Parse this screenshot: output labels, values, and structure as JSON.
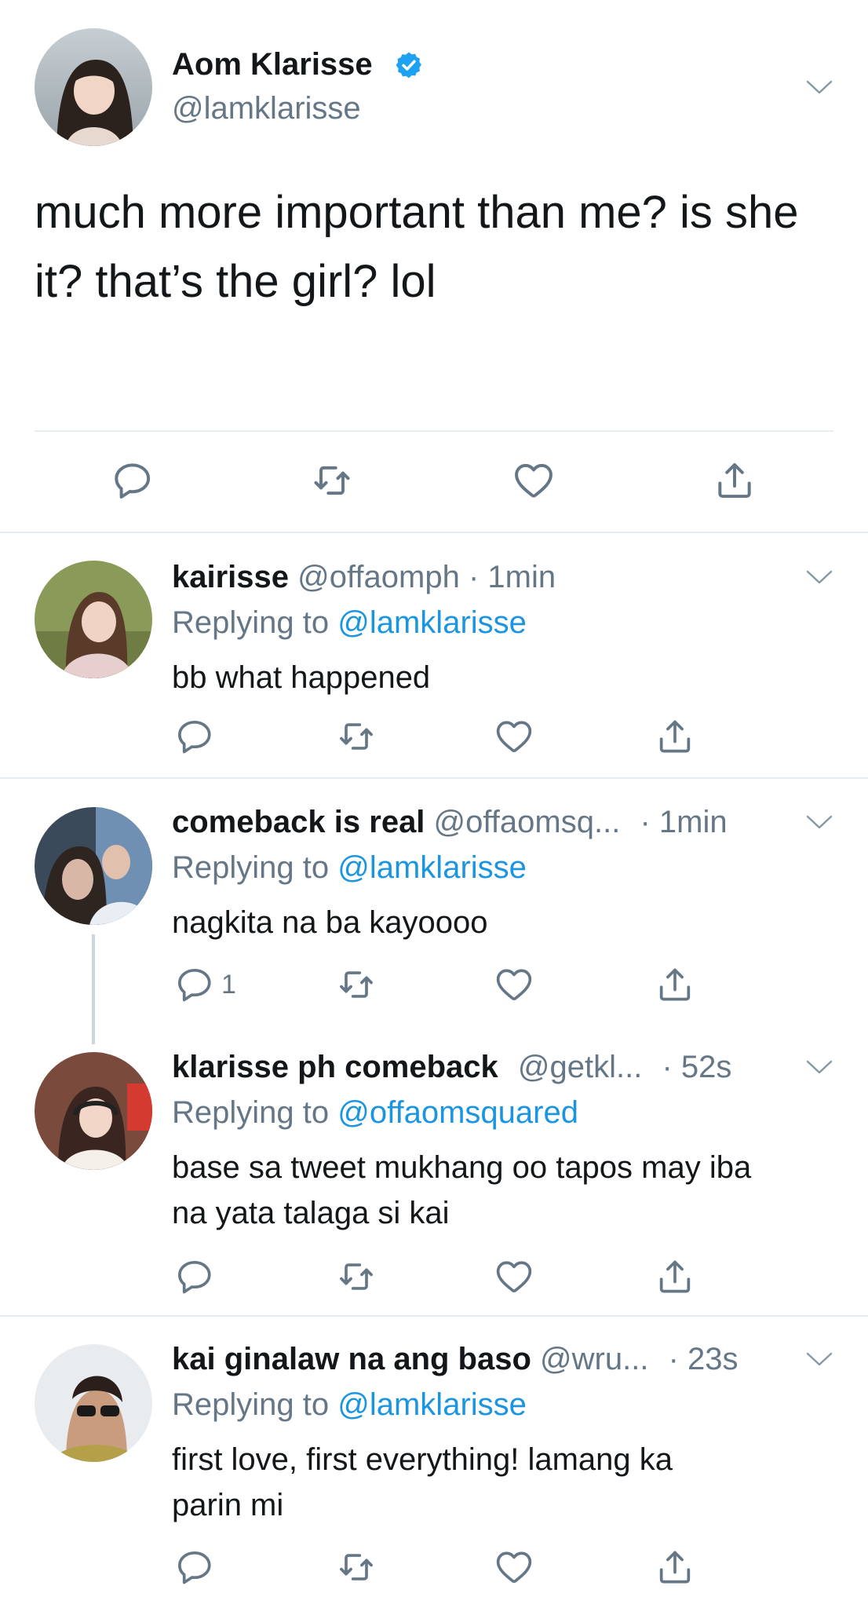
{
  "main_tweet": {
    "author_name": "Aom Klarisse",
    "handle": "@lamklarisse",
    "text_line1": "much more important than me? is she",
    "text_line2": "it? that’s the girl? lol"
  },
  "replies": [
    {
      "name": "kairisse",
      "handle": "@offaomph",
      "time": "· 1min",
      "replying_label": "Replying to",
      "replying_to": "@lamklarisse",
      "text_line1": "bb what happened",
      "text_line2": "",
      "reply_count": ""
    },
    {
      "name": "comeback is real",
      "handle": "@offaomsq...",
      "time": "· 1min",
      "replying_label": "Replying to",
      "replying_to": "@lamklarisse",
      "text_line1": "nagkita na ba kayoooo",
      "text_line2": "",
      "reply_count": "1"
    },
    {
      "name": "klarisse ph comeback",
      "handle": "@getkl...",
      "time": "· 52s",
      "replying_label": "Replying to",
      "replying_to": "@offaomsquared",
      "text_line1": "base sa tweet mukhang oo tapos may iba",
      "text_line2": "na yata talaga si kai",
      "reply_count": ""
    },
    {
      "name": "kai ginalaw na ang baso",
      "handle": "@wru...",
      "time": "· 23s",
      "replying_label": "Replying to",
      "replying_to": "@lamklarisse",
      "text_line1": "first love, first everything! lamang ka",
      "text_line2": "parin mi",
      "reply_count": ""
    }
  ],
  "icons": {
    "verified": "verified-badge-icon",
    "menu": "chevron-down-icon",
    "reply": "reply-icon",
    "retweet": "retweet-icon",
    "like": "heart-icon",
    "share": "share-icon"
  },
  "colors": {
    "link": "#1b95e0",
    "muted": "#657786",
    "text": "#14171a",
    "divider": "#e6ecf0"
  }
}
